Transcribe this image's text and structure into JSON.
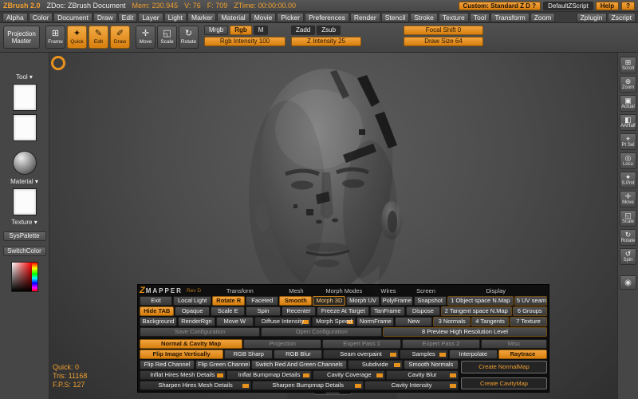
{
  "colors": {
    "accent": "#e8921e",
    "panel_dark": "#111111"
  },
  "titlebar": {
    "app_title": "ZBrush 2.0",
    "doc_title": "ZDoc: ZBrush Document",
    "mem": "Mem: 230.945",
    "verts": "V: 76",
    "faces": "F: 709",
    "ztime": "ZTime: 00:00:00.00",
    "custom": "Custom: Standard Z D ?",
    "zscript": "DefaultZScript",
    "help": "Help",
    "question": "?"
  },
  "menubar": {
    "items": [
      "Alpha",
      "Color",
      "Document",
      "Draw",
      "Edit",
      "Layer",
      "Light",
      "Marker",
      "Material",
      "Movie",
      "Picker",
      "Preferences",
      "Render",
      "Stencil",
      "Stroke",
      "Texture",
      "Tool",
      "Transform",
      "Zoom"
    ],
    "right_items": [
      "Zplugin",
      "Zscript"
    ]
  },
  "toolbar": {
    "projection_master": "Projection Master",
    "frame": "Frame",
    "quick": "Quick",
    "edit": "Edit",
    "draw": "Draw",
    "move": "Move",
    "scale": "Scale",
    "rotate": "Rotate",
    "icons": {
      "frame": "⊞",
      "quick": "✦",
      "edit": "✎",
      "draw": "✐",
      "move": "✛",
      "scale": "◱",
      "rotate": "↻"
    },
    "mrgb": "Mrgb",
    "rgb": "Rgb",
    "m": "M",
    "rgb_intensity": "Rgb Intensity 100",
    "zadd": "Zadd",
    "zsub": "Zsub",
    "z_intensity": "Z Intensity 25",
    "focal_shift": "Focal Shift 0",
    "draw_size": "Draw Size 64"
  },
  "sidebar": {
    "tool": "Tool ▾",
    "material": "Material ▾",
    "texture": "Texture ▾",
    "syspalette": "SysPalette",
    "switchcolor": "SwitchColor"
  },
  "rightbar": {
    "items": [
      {
        "label": "Scroll",
        "glyph": "⊞"
      },
      {
        "label": "Zoom",
        "glyph": "⊕"
      },
      {
        "label": "Actual",
        "glyph": "▣"
      },
      {
        "label": "AAHalf",
        "glyph": "◧"
      },
      {
        "label": "Pt Sel",
        "glyph": "⌖"
      },
      {
        "label": "Locu",
        "glyph": "◎"
      },
      {
        "label": "S.Pmt",
        "glyph": "✦"
      },
      {
        "label": "Move",
        "glyph": "✛"
      },
      {
        "label": "Scale",
        "glyph": "◱"
      },
      {
        "label": "Rotate",
        "glyph": "↻"
      },
      {
        "label": "Spin",
        "glyph": "↺"
      }
    ],
    "camera_glyph": "◉"
  },
  "canvas": {
    "status": {
      "quick": "Quick: 0",
      "tris": "Tris: 11168",
      "fps": "F.P.S: 127"
    }
  },
  "zmapper": {
    "logo_z": "Z",
    "logo_rest": "MAPPER",
    "rev": "Rev D",
    "headers": [
      "Transform",
      "Mesh",
      "Morph Modes",
      "Wires",
      "Screen",
      "Display"
    ],
    "row1": [
      "Exit",
      "Local Light",
      "Rotate R",
      "Faceted",
      "Smooth",
      "Morph 3D",
      "Morph UV",
      "PolyFrame",
      "Snapshot",
      "1 Object space N.Map",
      "5 UV seams"
    ],
    "row2": [
      "Hide TAB",
      "Opaque",
      "Scale E",
      "Spin",
      "Recenter",
      "Freeze At Target",
      "TanFrame",
      "Dispose",
      "2 Tangent space N.Map",
      "6 Groups"
    ],
    "row3": [
      "Background",
      "RenderRgn",
      "Move W",
      "Diffuse Intensity",
      "Morph Speed",
      "NormFrame",
      "New",
      "3 Normals",
      "4 Tangents",
      "7 Texture"
    ],
    "row4": [
      "Save Configuration",
      "Open Configuration",
      "8 Preview High Resolution Level"
    ],
    "tabs2": [
      "Normal & Cavity Map",
      "Projection",
      "Expert Pass 1",
      "Expert Pass 2",
      "Misc"
    ],
    "rowA": [
      "Flip Image Vertically",
      "RGB Sharp",
      "RGB Blur",
      "Seam overpaint",
      "Samples",
      "Interpolate",
      "Raytrace"
    ],
    "rowB": [
      "Flip Red Channel",
      "Flip Green Channel",
      "Switch Red And Green Channels",
      "Subdivide",
      "Smooth Normals"
    ],
    "rowC": [
      "Inflat Hires Mesh Details",
      "Inflat Bumpmap Details",
      "Cavity Coverage",
      "Cavity Blur"
    ],
    "rowD": [
      "Sharpen Hires Mesh Details",
      "Sharpen Bumpmap Details",
      "Cavity Intensity"
    ],
    "create_normalmap": "Create NormalMap",
    "create_cavitymap": "Create CavityMap"
  }
}
